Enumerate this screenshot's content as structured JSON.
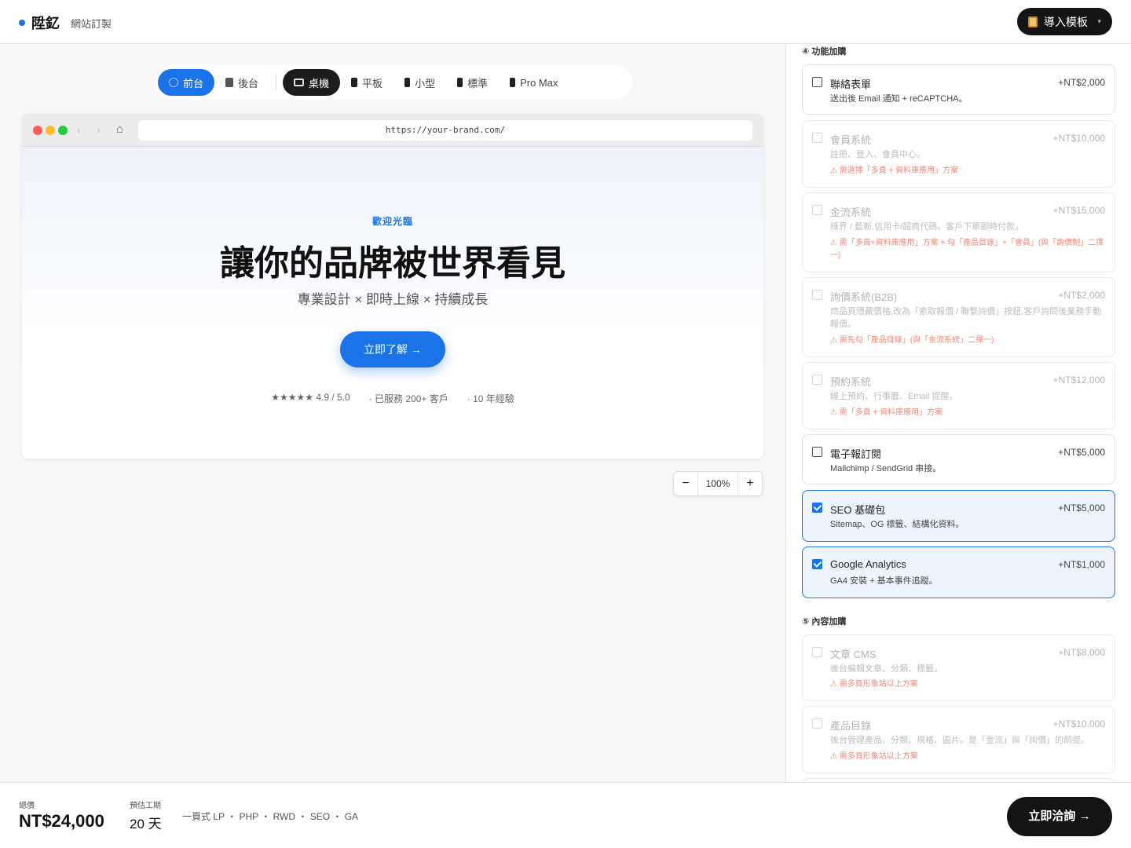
{
  "header": {
    "brand_name": "陞釔",
    "brand_sub": "網站訂製",
    "import_label": "導入模板",
    "import_caret": "▾"
  },
  "segments": {
    "frontend": "前台",
    "backend": "後台",
    "desktop": "桌機",
    "tablet": "平板",
    "small": "小型",
    "standard": "標準",
    "promax": "Pro Max"
  },
  "browser": {
    "back": "‹",
    "forward": "›",
    "home": "⌂",
    "url": "https://your-brand.com/"
  },
  "hero": {
    "kicker": "歡迎光臨",
    "title": "讓你的品牌被世界看見",
    "subtitle": "專業設計 × 即時上線 × 持續成長",
    "cta": "立即了解 →",
    "stat_rating": "★★★★★ 4.9 / 5.0",
    "stat_clients": "· 已服務 200+ 客戶",
    "stat_years": "· 10 年經驗"
  },
  "zoom": {
    "minus": "−",
    "value": "100%",
    "plus": "+"
  },
  "addons": {
    "section_title": "④ 功能加購",
    "items": [
      {
        "title": "聯絡表單",
        "price": "+NT$2,000",
        "desc": "送出後 Email 通知 + reCAPTCHA。",
        "warn": "",
        "state": "unchecked"
      },
      {
        "title": "會員系統",
        "price": "+NT$10,000",
        "desc": "註冊、登入、會員中心。",
        "warn": "⚠ 需選擇「多頁 + 資料庫應用」方案",
        "state": "disabled"
      },
      {
        "title": "金流系統",
        "price": "+NT$15,000",
        "desc": "綠界 / 藍新,信用卡/超商代碼。客戶下單即時付款。",
        "warn": "⚠ 需「多頁+資料庫應用」方案 + 勾「產品目錄」+「會員」(與「詢價制」二擇一)",
        "state": "disabled"
      },
      {
        "title": "詢價系統(B2B)",
        "price": "+NT$2,000",
        "desc": "商品頁隱藏價格,改為「索取報價 / 聯繫詢價」按鈕,客戶詢問後業務手動報價。",
        "warn": "⚠ 需先勾「產品目錄」(與「金流系統」二擇一)",
        "state": "disabled"
      },
      {
        "title": "預約系統",
        "price": "+NT$12,000",
        "desc": "線上預約、行事曆、Email 提醒。",
        "warn": "⚠ 需「多頁 + 資料庫應用」方案",
        "state": "disabled"
      },
      {
        "title": "電子報訂閱",
        "price": "+NT$5,000",
        "desc": "Mailchimp / SendGrid 串接。",
        "warn": "",
        "state": "unchecked"
      },
      {
        "title": "SEO 基礎包",
        "price": "+NT$5,000",
        "desc": "Sitemap、OG 標籤、結構化資料。",
        "warn": "",
        "state": "checked"
      },
      {
        "title": "Google Analytics",
        "price": "+NT$1,000",
        "desc": "GA4 安裝 + 基本事件追蹤。",
        "warn": "",
        "state": "checked"
      }
    ]
  },
  "content_addons": {
    "section_title": "⑤ 內容加購",
    "items": [
      {
        "title": "文章 CMS",
        "price": "+NT$8,000",
        "desc": "後台編輯文章、分類、標籤。",
        "warn": "⚠ 需多頁形象站以上方案",
        "state": "disabled"
      },
      {
        "title": "產品目錄",
        "price": "+NT$10,000",
        "desc": "後台管理產品、分類、規格、圖片。是「金流」與「詢價」的前提。",
        "warn": "⚠ 需多頁形象站以上方案",
        "state": "disabled"
      }
    ]
  },
  "footer": {
    "total_label": "總價",
    "total_value": "NT$24,000",
    "days_label": "預估工期",
    "days_value": "20 天",
    "tags": "一頁式 LP ・ PHP ・ RWD ・ SEO ・ GA",
    "cta": "立即洽詢 →"
  },
  "colors": {
    "accent": "#1a73e8",
    "dark": "#141414",
    "warning": "#f08a7a"
  }
}
